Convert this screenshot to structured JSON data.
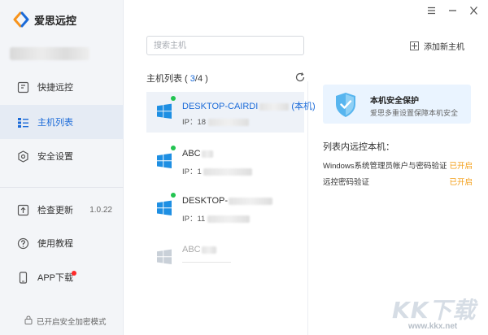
{
  "app": {
    "title": "爱思远控"
  },
  "window_controls": {
    "menu": "menu-icon",
    "minimize": "minimize-icon",
    "close": "close-icon"
  },
  "sidebar": {
    "items": [
      {
        "label": "快捷远控",
        "icon": "monitor-icon",
        "active": false
      },
      {
        "label": "主机列表",
        "icon": "list-icon",
        "active": true
      },
      {
        "label": "安全设置",
        "icon": "shield-hex-icon",
        "active": false
      }
    ],
    "bottom_items": [
      {
        "label": "检查更新",
        "icon": "upload-icon",
        "badge": "1.0.22"
      },
      {
        "label": "使用教程",
        "icon": "help-icon"
      },
      {
        "label": "APP下载",
        "icon": "phone-icon",
        "has_dot": true
      }
    ],
    "status": "已开启安全加密模式"
  },
  "search": {
    "placeholder": "搜索主机",
    "value": ""
  },
  "add_host": {
    "label": "添加新主机"
  },
  "host_list": {
    "title_prefix": "主机列表 ( ",
    "current": "3",
    "title_suffix": "/4 )",
    "hosts": [
      {
        "name": "DESKTOP-CAIRDI",
        "suffix": "(本机)",
        "ip_label": "IP：18",
        "online": true,
        "selected": true,
        "dim": false
      },
      {
        "name": "ABC",
        "suffix": "",
        "ip_label": "IP：1",
        "online": true,
        "selected": false,
        "dim": false
      },
      {
        "name": "DESKTOP-",
        "suffix": "",
        "ip_label": "IP：11",
        "online": true,
        "selected": false,
        "dim": false
      },
      {
        "name": "ABC",
        "suffix": "",
        "ip_label": "",
        "online": false,
        "selected": false,
        "dim": true
      }
    ]
  },
  "security_card": {
    "title": "本机安全保护",
    "subtitle": "爱思多重设置保障本机安全"
  },
  "remote_section": {
    "title": "列表内远控本机：",
    "options": [
      {
        "label": "Windows系统管理员帐户与密码验证",
        "status": "已开启"
      },
      {
        "label": "远控密码验证",
        "status": "已开启"
      }
    ]
  },
  "watermark": {
    "big": "KK下载",
    "small": "www.kkx.net"
  },
  "colors": {
    "accent": "#1a6ad8",
    "online": "#23c451",
    "status_on": "#f39c12",
    "badge": "#ff2a2a"
  }
}
